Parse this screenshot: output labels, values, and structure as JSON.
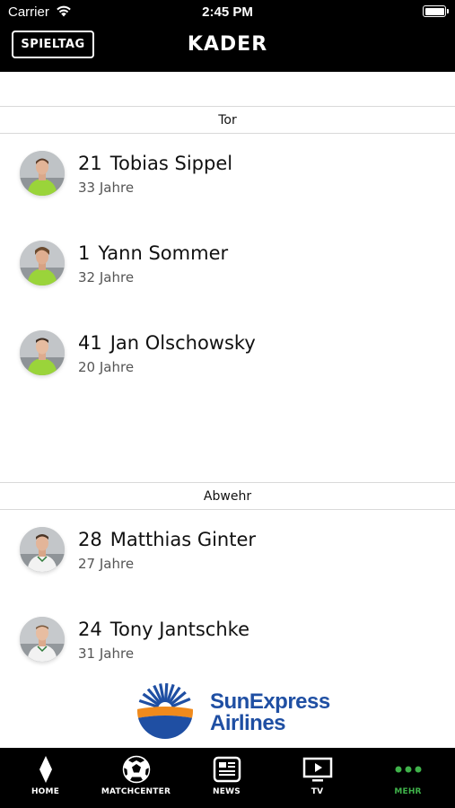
{
  "status_bar": {
    "carrier": "Carrier",
    "time": "2:45 PM"
  },
  "nav": {
    "left_button": "SPIELTAG",
    "title": "KADER"
  },
  "sections": [
    {
      "title": "Tor",
      "players": [
        {
          "number": "21",
          "name": "Tobias Sippel",
          "age": "33 Jahre"
        },
        {
          "number": "1",
          "name": "Yann Sommer",
          "age": "32 Jahre"
        },
        {
          "number": "41",
          "name": "Jan Olschowsky",
          "age": "20 Jahre"
        }
      ]
    },
    {
      "title": "Abwehr",
      "players": [
        {
          "number": "28",
          "name": "Matthias Ginter",
          "age": "27 Jahre"
        },
        {
          "number": "24",
          "name": "Tony Jantschke",
          "age": "31 Jahre"
        }
      ]
    }
  ],
  "sponsor": {
    "line1": "SunExpress",
    "line2": "Airlines"
  },
  "tabbar": {
    "items": [
      {
        "label": "HOME",
        "icon": "diamond-icon"
      },
      {
        "label": "MATCHCENTER",
        "icon": "soccer-ball-icon"
      },
      {
        "label": "NEWS",
        "icon": "newspaper-icon"
      },
      {
        "label": "TV",
        "icon": "tv-play-icon"
      },
      {
        "label": "MEHR",
        "icon": "more-dots-icon"
      }
    ],
    "active_index": 4
  },
  "colors": {
    "active_tab": "#3fb24a",
    "goalkeeper_kit": "#9ad43a",
    "defender_kit": "#f2f2f2",
    "sponsor_blue": "#1f4fa3",
    "sponsor_orange": "#f08a1c"
  }
}
